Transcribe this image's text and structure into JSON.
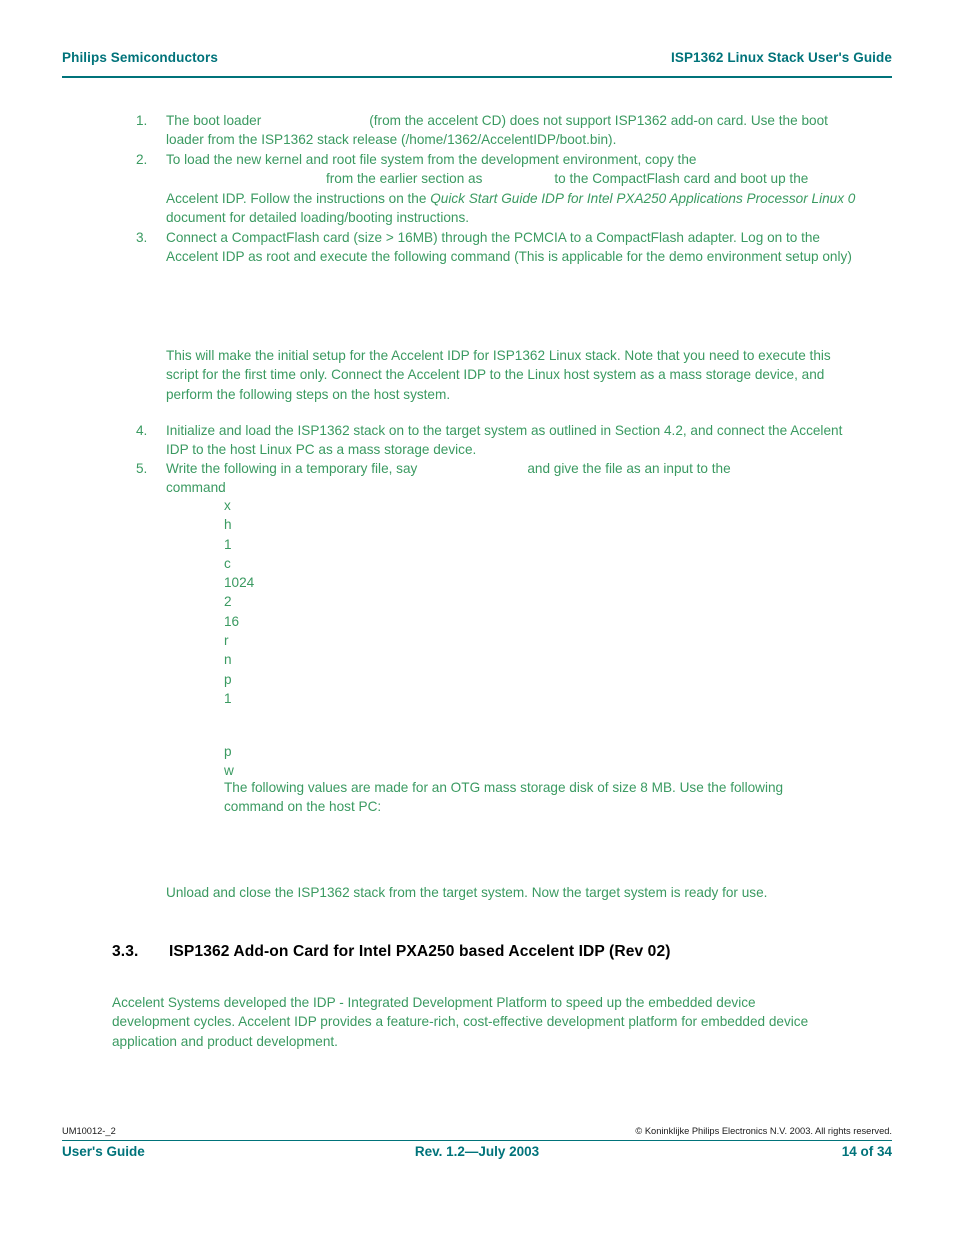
{
  "header": {
    "left": "Philips Semiconductors",
    "right": "ISP1362 Linux Stack User's Guide"
  },
  "colors": {
    "header_teal": "#00737a",
    "body_green": "#3a9a61",
    "heading_black": "#000000"
  },
  "list": {
    "items": [
      {
        "num": "1.",
        "text_before": "The boot loader",
        "text_after": "(from the accelent CD) does not support ISP1362 add-on card. Use the boot loader from the ISP1362 stack release (/home/1362/AccelentIDP/boot.bin)."
      },
      {
        "num": "2.",
        "line1": "To load the new kernel and root file system from the development environment, copy the",
        "line2_a": "from the earlier section as",
        "line2_b": "to the CompactFlash card and boot up the Accelent IDP. Follow the instructions on the",
        "italic1": "Quick Start Guide IDP for Intel PXA250 Applications Processor Linux 0",
        "line3_tail": "document for detailed loading/booting instructions."
      },
      {
        "num": "3.",
        "text": "Connect a CompactFlash card (size > 16MB) through the PCMCIA to a CompactFlash adapter. Log on to the Accelent IDP as root and execute the following command (This is applicable for the demo environment setup only)"
      },
      {
        "num": "4.",
        "text": "Initialize and load the ISP1362 stack on to the target system as outlined in Section 4.2, and connect the Accelent IDP to the host Linux PC as a mass storage device."
      },
      {
        "num": "5.",
        "text_a": "Write the following in a temporary file, say",
        "text_b": "and give the file as an input to the command"
      }
    ]
  },
  "paragraphs": {
    "after_step3": "This will make the initial setup for the Accelent IDP for ISP1362 Linux stack. Note that you need to execute this script for the first time only. Connect the Accelent IDP to the Linux host system as a mass storage device, and perform the following steps on the host system.",
    "otg_note": "The following values are made for an OTG mass storage disk of size 8 MB. Use the following command on the host PC:",
    "unload": "Unload and close the ISP1362 stack from the target system. Now the target system is ready for use.",
    "section_body": "Accelent Systems developed the IDP - Integrated Development Platform to speed up the embedded device development cycles. Accelent IDP provides a feature-rich, cost-effective development platform for embedded device application and product development."
  },
  "char_column": {
    "group1": [
      "x",
      "h",
      "1",
      "c",
      "1024",
      "2",
      "16",
      "r",
      "n",
      "p",
      "1"
    ],
    "group2": [
      "p",
      "w"
    ]
  },
  "section": {
    "number": "3.3.",
    "title": "ISP1362 Add-on Card for Intel PXA250 based Accelent IDP (Rev 02)"
  },
  "footer": {
    "doc_id": "UM10012-_2",
    "copyright": "© Koninklijke Philips Electronics N.V. 2003. All rights reserved.",
    "left": "User's Guide",
    "center": "Rev. 1.2—July 2003",
    "right": "14 of 34"
  }
}
